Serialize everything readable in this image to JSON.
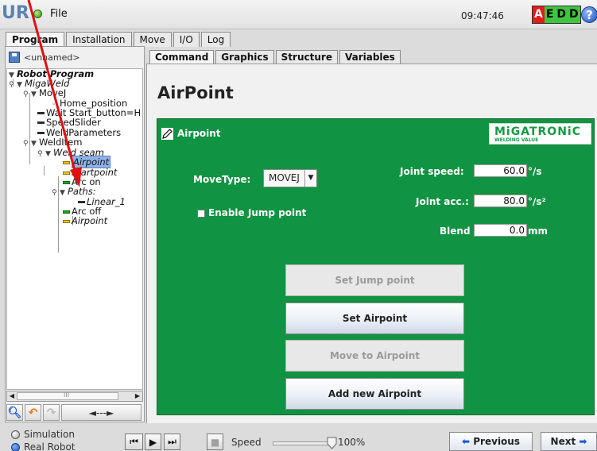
{
  "titlebar": {
    "logo_text": "UR",
    "menu_file": "File",
    "clock": "09:47:46",
    "status_badge": [
      "A",
      "E",
      "D",
      "D"
    ],
    "help": "?"
  },
  "main_tabs": [
    "Program",
    "Installation",
    "Move",
    "I/O",
    "Log"
  ],
  "main_tabs_active": "Program",
  "left_panel": {
    "program_name": "<unnamed>",
    "tree": [
      "Robot Program",
      "MigaWeld",
      "MoveJ",
      "Home_position",
      "Wait Start_button=H",
      "SpeedSlider",
      "WeldParameters",
      "WeldItem",
      "Weld seam",
      "Airpoint",
      "Startpoint",
      "Arc on",
      "Paths:",
      "Linear_1",
      "Arc off",
      "Airpoint"
    ],
    "hscroll_thumb": "III",
    "expand_label": "◄---►"
  },
  "content_tabs": [
    "Command",
    "Graphics",
    "Structure",
    "Variables"
  ],
  "content_tabs_active": "Command",
  "page_title": "AirPoint",
  "panel": {
    "title": "Airpoint",
    "logo_brand": "MiGATRONiC",
    "logo_sub": "WELDING VALUE",
    "movetype_label": "MoveType:",
    "movetype_value": "MOVEJ",
    "enable_jump_label": "Enable Jump point",
    "enable_jump_checked": false,
    "joint_speed_label": "Joint speed:",
    "joint_speed_value": "60.0",
    "joint_speed_unit": "°/s",
    "joint_acc_label": "Joint acc.:",
    "joint_acc_value": "80.0",
    "joint_acc_unit": "°/s²",
    "blend_label": "Blend",
    "blend_value": "0.0",
    "blend_unit": "mm",
    "buttons": {
      "set_jump_point": "Set Jump point",
      "set_airpoint": "Set Airpoint",
      "move_to_airpoint": "Move to Airpoint",
      "add_new_airpoint": "Add new Airpoint"
    }
  },
  "bottom": {
    "simulation_label": "Simulation",
    "real_robot_label": "Real Robot",
    "speed_label": "Speed",
    "speed_value": "100%",
    "speed_fraction": 1.0,
    "previous_label": "Previous",
    "next_label": "Next"
  },
  "colors": {
    "panel_green": "#109342",
    "selection_blue": "#8fb2e8",
    "annotation_red": "#e01010"
  }
}
